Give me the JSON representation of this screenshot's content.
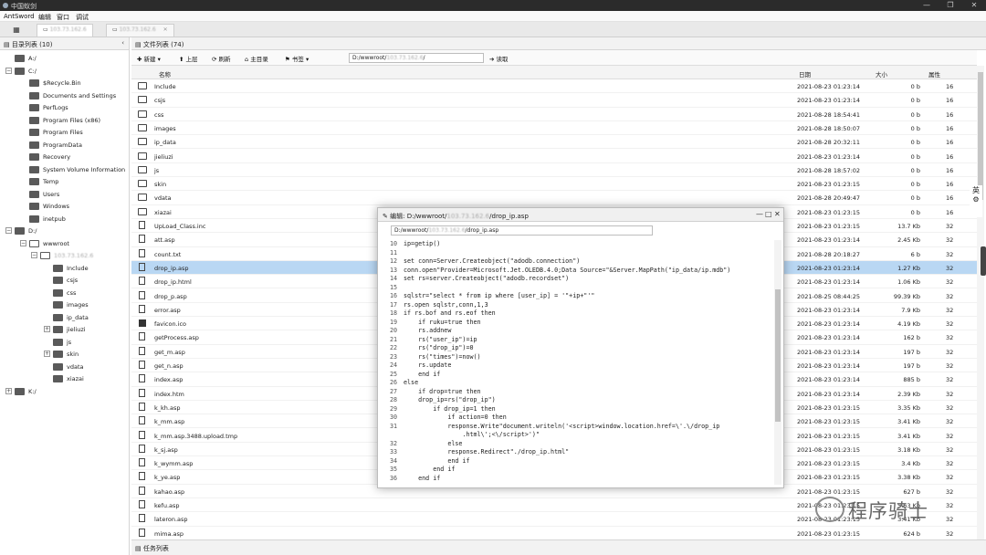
{
  "window": {
    "title": "中国蚁剑",
    "controls": [
      "—",
      "❐",
      "✕"
    ]
  },
  "menu": [
    "AntSword",
    "编辑",
    "窗口",
    "调试"
  ],
  "tabs": [
    {
      "label": "103.73.162.6",
      "active": true,
      "blurred": true
    },
    {
      "label": "103.73.162.6",
      "active": false,
      "blurred": true
    }
  ],
  "left": {
    "title": "目录列表 (10)",
    "tree": [
      {
        "label": "A:/",
        "depth": 0,
        "toggle": "",
        "open": false
      },
      {
        "label": "C:/",
        "depth": 0,
        "toggle": "−",
        "open": true
      },
      {
        "label": "$Recycle.Bin",
        "depth": 1,
        "toggle": "",
        "open": false
      },
      {
        "label": "Documents and Settings",
        "depth": 1,
        "toggle": "",
        "open": false
      },
      {
        "label": "PerfLogs",
        "depth": 1,
        "toggle": "",
        "open": false
      },
      {
        "label": "Program Files (x86)",
        "depth": 1,
        "toggle": "",
        "open": false
      },
      {
        "label": "Program Files",
        "depth": 1,
        "toggle": "",
        "open": false
      },
      {
        "label": "ProgramData",
        "depth": 1,
        "toggle": "",
        "open": false
      },
      {
        "label": "Recovery",
        "depth": 1,
        "toggle": "",
        "open": false
      },
      {
        "label": "System Volume Information",
        "depth": 1,
        "toggle": "",
        "open": false
      },
      {
        "label": "Temp",
        "depth": 1,
        "toggle": "",
        "open": false
      },
      {
        "label": "Users",
        "depth": 1,
        "toggle": "",
        "open": false
      },
      {
        "label": "Windows",
        "depth": 1,
        "toggle": "",
        "open": false
      },
      {
        "label": "inetpub",
        "depth": 1,
        "toggle": "",
        "open": false
      },
      {
        "label": "D:/",
        "depth": 0,
        "toggle": "−",
        "open": true
      },
      {
        "label": "wwwroot",
        "depth": 1,
        "toggle": "−",
        "open": true
      },
      {
        "label": "103.73.162.6",
        "depth": 2,
        "toggle": "−",
        "open": true,
        "blurred": true
      },
      {
        "label": "Include",
        "depth": 3,
        "toggle": "",
        "open": false
      },
      {
        "label": "csjs",
        "depth": 3,
        "toggle": "",
        "open": false
      },
      {
        "label": "css",
        "depth": 3,
        "toggle": "",
        "open": false
      },
      {
        "label": "images",
        "depth": 3,
        "toggle": "",
        "open": false
      },
      {
        "label": "ip_data",
        "depth": 3,
        "toggle": "",
        "open": false
      },
      {
        "label": "jieliuzi",
        "depth": 3,
        "toggle": "+",
        "open": false
      },
      {
        "label": "js",
        "depth": 3,
        "toggle": "",
        "open": false
      },
      {
        "label": "skin",
        "depth": 3,
        "toggle": "+",
        "open": false
      },
      {
        "label": "vdata",
        "depth": 3,
        "toggle": "",
        "open": false
      },
      {
        "label": "xiazai",
        "depth": 3,
        "toggle": "",
        "open": false
      },
      {
        "label": "K:/",
        "depth": 0,
        "toggle": "+",
        "open": false
      }
    ]
  },
  "files": {
    "title": "文件列表 (74)",
    "toolbar": {
      "new": "新建",
      "up": "上层",
      "refresh": "刷新",
      "home": "主目录",
      "bookmark": "书签",
      "path_prefix": "D:/wwwroot/",
      "path_host": "103.73.162.6",
      "path_suffix": "/",
      "go": "读取"
    },
    "columns": [
      "名称",
      "日期",
      "大小",
      "属性"
    ],
    "rows": [
      {
        "type": "folder",
        "name": "Include",
        "date": "2021-08-23 01:23:14",
        "size": "0 b",
        "attr": "16"
      },
      {
        "type": "folder",
        "name": "csjs",
        "date": "2021-08-23 01:23:14",
        "size": "0 b",
        "attr": "16"
      },
      {
        "type": "folder",
        "name": "css",
        "date": "2021-08-28 18:54:41",
        "size": "0 b",
        "attr": "16"
      },
      {
        "type": "folder",
        "name": "images",
        "date": "2021-08-28 18:50:07",
        "size": "0 b",
        "attr": "16"
      },
      {
        "type": "folder",
        "name": "ip_data",
        "date": "2021-08-28 20:32:11",
        "size": "0 b",
        "attr": "16"
      },
      {
        "type": "folder",
        "name": "jieliuzi",
        "date": "2021-08-23 01:23:14",
        "size": "0 b",
        "attr": "16"
      },
      {
        "type": "folder",
        "name": "js",
        "date": "2021-08-28 18:57:02",
        "size": "0 b",
        "attr": "16"
      },
      {
        "type": "folder",
        "name": "skin",
        "date": "2021-08-23 01:23:15",
        "size": "0 b",
        "attr": "16"
      },
      {
        "type": "folder",
        "name": "vdata",
        "date": "2021-08-28 20:49:47",
        "size": "0 b",
        "attr": "16"
      },
      {
        "type": "folder",
        "name": "xiazai",
        "date": "2021-08-23 01:23:15",
        "size": "0 b",
        "attr": "16"
      },
      {
        "type": "file",
        "name": "UpLoad_Class.inc",
        "date": "2021-08-23 01:23:15",
        "size": "13.7 Kb",
        "attr": "32"
      },
      {
        "type": "file",
        "name": "att.asp",
        "date": "2021-08-23 01:23:14",
        "size": "2.45 Kb",
        "attr": "32"
      },
      {
        "type": "file",
        "name": "count.txt",
        "date": "2021-08-28 20:18:27",
        "size": "6 b",
        "attr": "32"
      },
      {
        "type": "file",
        "name": "drop_ip.asp",
        "date": "2021-08-23 01:23:14",
        "size": "1.27 Kb",
        "attr": "32",
        "selected": true
      },
      {
        "type": "file",
        "name": "drop_ip.html",
        "date": "2021-08-23 01:23:14",
        "size": "1.06 Kb",
        "attr": "32"
      },
      {
        "type": "file",
        "name": "drop_p.asp",
        "date": "2021-08-25 08:44:25",
        "size": "99.39 Kb",
        "attr": "32"
      },
      {
        "type": "file",
        "name": "error.asp",
        "date": "2021-08-23 01:23:14",
        "size": "7.9 Kb",
        "attr": "32"
      },
      {
        "type": "image",
        "name": "favicon.ico",
        "date": "2021-08-23 01:23:14",
        "size": "4.19 Kb",
        "attr": "32"
      },
      {
        "type": "file",
        "name": "getProcess.asp",
        "date": "2021-08-23 01:23:14",
        "size": "162 b",
        "attr": "32"
      },
      {
        "type": "file",
        "name": "get_m.asp",
        "date": "2021-08-23 01:23:14",
        "size": "197 b",
        "attr": "32"
      },
      {
        "type": "file",
        "name": "get_n.asp",
        "date": "2021-08-23 01:23:14",
        "size": "197 b",
        "attr": "32"
      },
      {
        "type": "file",
        "name": "index.asp",
        "date": "2021-08-23 01:23:14",
        "size": "885 b",
        "attr": "32"
      },
      {
        "type": "file",
        "name": "index.htm",
        "date": "2021-08-23 01:23:14",
        "size": "2.39 Kb",
        "attr": "32"
      },
      {
        "type": "file",
        "name": "k_kh.asp",
        "date": "2021-08-23 01:23:15",
        "size": "3.35 Kb",
        "attr": "32"
      },
      {
        "type": "file",
        "name": "k_mm.asp",
        "date": "2021-08-23 01:23:15",
        "size": "3.41 Kb",
        "attr": "32"
      },
      {
        "type": "file",
        "name": "k_mm.asp.3488.upload.tmp",
        "date": "2021-08-23 01:23:15",
        "size": "3.41 Kb",
        "attr": "32"
      },
      {
        "type": "file",
        "name": "k_sj.asp",
        "date": "2021-08-23 01:23:15",
        "size": "3.18 Kb",
        "attr": "32"
      },
      {
        "type": "file",
        "name": "k_wymm.asp",
        "date": "2021-08-23 01:23:15",
        "size": "3.4 Kb",
        "attr": "32"
      },
      {
        "type": "file",
        "name": "k_ye.asp",
        "date": "2021-08-23 01:23:15",
        "size": "3.38 Kb",
        "attr": "32"
      },
      {
        "type": "file",
        "name": "kahao.asp",
        "date": "2021-08-23 01:23:15",
        "size": "627 b",
        "attr": "32"
      },
      {
        "type": "file",
        "name": "kefu.asp",
        "date": "2021-08-23 01:23:15",
        "size": "5.63 Kb",
        "attr": "32"
      },
      {
        "type": "file",
        "name": "lateron.asp",
        "date": "2021-08-23 01:23:15",
        "size": "3.41 Kb",
        "attr": "32"
      },
      {
        "type": "file",
        "name": "mima.asp",
        "date": "2021-08-23 01:23:15",
        "size": "624 b",
        "attr": "32"
      }
    ]
  },
  "taskbar": {
    "label": "任务列表"
  },
  "editor": {
    "title_prefix": "编辑: D:/wwwroot/",
    "title_host": "103.73.162.6",
    "title_suffix": "/drop_ip.asp",
    "path_prefix": "D:/wwwroot/",
    "path_host": "103.73.162.6",
    "path_suffix": "/drop_ip.asp",
    "controls": [
      "—",
      "□",
      "✕"
    ],
    "lines": [
      {
        "n": "10",
        "t": "ip=getip()"
      },
      {
        "n": "11",
        "t": ""
      },
      {
        "n": "12",
        "t": "set conn=Server.Createobject(\"adodb.connection\")"
      },
      {
        "n": "13",
        "t": "conn.open\"Provider=Microsoft.Jet.OLEDB.4.0;Data Source=\"&Server.MapPath(\"ip_data/ip.mdb\")"
      },
      {
        "n": "14",
        "t": "set rs=server.Createobject(\"adodb.recordset\")"
      },
      {
        "n": "15",
        "t": ""
      },
      {
        "n": "16",
        "t": "sqlstr=\"select * from ip where [user_ip] = '\"+ip+\"'\""
      },
      {
        "n": "17",
        "t": "rs.open sqlstr,conn,1,3"
      },
      {
        "n": "18",
        "t": "if rs.bof and rs.eof then"
      },
      {
        "n": "19",
        "t": "    if ruku=true then"
      },
      {
        "n": "20",
        "t": "    rs.addnew"
      },
      {
        "n": "21",
        "t": "    rs(\"user_ip\")=ip"
      },
      {
        "n": "22",
        "t": "    rs(\"drop_ip\")=0"
      },
      {
        "n": "23",
        "t": "    rs(\"times\")=now()"
      },
      {
        "n": "24",
        "t": "    rs.update"
      },
      {
        "n": "25",
        "t": "    end if"
      },
      {
        "n": "26",
        "t": "else"
      },
      {
        "n": "27",
        "t": "    if drop=true then"
      },
      {
        "n": "28",
        "t": "    drop_ip=rs(\"drop_ip\")"
      },
      {
        "n": "29",
        "t": "        if drop_ip=1 then"
      },
      {
        "n": "30",
        "t": "            if action=0 then"
      },
      {
        "n": "31",
        "t": "            response.Write\"document.writeln('<script>window.location.href=\\'.\\/drop_ip"
      },
      {
        "n": "",
        "t": "                .html\\';<\\/script>')\""
      },
      {
        "n": "32",
        "t": "            else"
      },
      {
        "n": "33",
        "t": "            response.Redirect\"./drop_ip.html\""
      },
      {
        "n": "34",
        "t": "            end if"
      },
      {
        "n": "35",
        "t": "        end if"
      },
      {
        "n": "36",
        "t": "    end if"
      }
    ]
  },
  "ime": {
    "label": "英",
    "gear": "⚙"
  },
  "watermark": {
    "text": "程序骑士"
  }
}
